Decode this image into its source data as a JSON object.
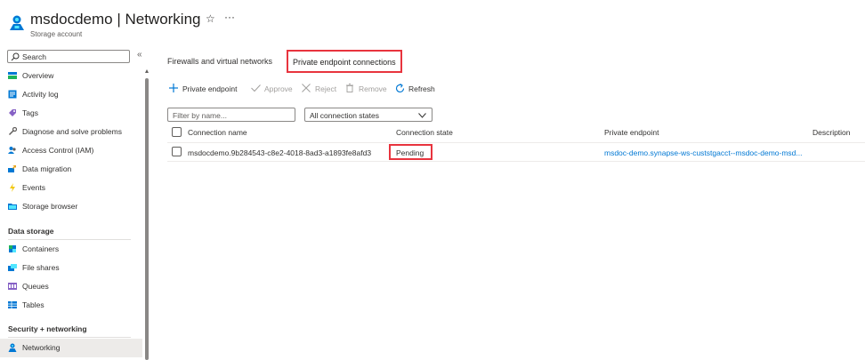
{
  "header": {
    "title": "msdocdemo | Networking",
    "subtitle": "Storage account",
    "star_icon": "☆",
    "more_icon": "···"
  },
  "sidebar": {
    "search_placeholder": "Search",
    "collapse_icon": "«",
    "items": [
      {
        "label": "Overview",
        "icon": "overview-icon"
      },
      {
        "label": "Activity log",
        "icon": "activity-log-icon"
      },
      {
        "label": "Tags",
        "icon": "tag-icon"
      },
      {
        "label": "Diagnose and solve problems",
        "icon": "wrench-icon"
      },
      {
        "label": "Access Control (IAM)",
        "icon": "people-icon"
      },
      {
        "label": "Data migration",
        "icon": "migration-icon"
      },
      {
        "label": "Events",
        "icon": "lightning-icon"
      },
      {
        "label": "Storage browser",
        "icon": "folder-icon"
      }
    ],
    "sections": [
      {
        "title": "Data storage",
        "items": [
          {
            "label": "Containers",
            "icon": "containers-icon"
          },
          {
            "label": "File shares",
            "icon": "file-shares-icon"
          },
          {
            "label": "Queues",
            "icon": "queues-icon"
          },
          {
            "label": "Tables",
            "icon": "tables-icon"
          }
        ]
      },
      {
        "title": "Security + networking",
        "items": [
          {
            "label": "Networking",
            "icon": "networking-icon",
            "active": true
          }
        ]
      }
    ]
  },
  "tabs": [
    {
      "label": "Firewalls and virtual networks",
      "selected": false
    },
    {
      "label": "Private endpoint connections",
      "selected": true
    }
  ],
  "toolbar": {
    "add_label": "Private endpoint",
    "approve_label": "Approve",
    "reject_label": "Reject",
    "remove_label": "Remove",
    "refresh_label": "Refresh"
  },
  "filters": {
    "name_placeholder": "Filter by name...",
    "state_value": "All connection states"
  },
  "table": {
    "columns": [
      "Connection name",
      "Connection state",
      "Private endpoint",
      "Description"
    ],
    "rows": [
      {
        "name": "msdocdemo.9b284543-c8e2-4018-8ad3-a1893fe8afd3",
        "state": "Pending",
        "endpoint": "msdoc-demo.synapse-ws-custstgacct--msdoc-demo-msd...",
        "description": ""
      }
    ]
  },
  "colors": {
    "accent": "#0078d4",
    "highlight": "#e8343e"
  }
}
